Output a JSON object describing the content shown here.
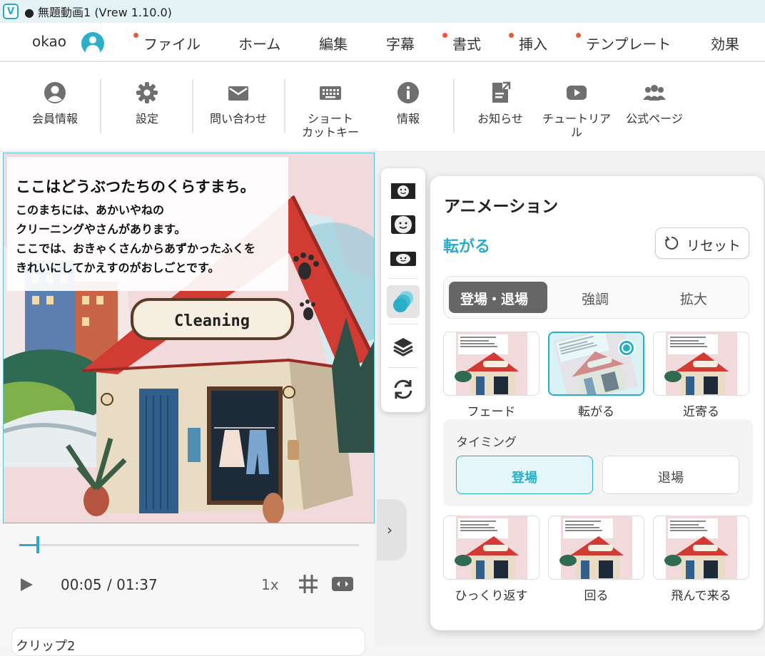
{
  "window": {
    "title": "● 無題動画1 (Vrew 1.10.0)",
    "logo_letter": "V"
  },
  "menubar": {
    "user_name": "okao",
    "items": [
      {
        "label": "ファイル",
        "dot": true
      },
      {
        "label": "ホーム",
        "dot": false
      },
      {
        "label": "編集",
        "dot": false
      },
      {
        "label": "字幕",
        "dot": false
      },
      {
        "label": "書式",
        "dot": true
      },
      {
        "label": "挿入",
        "dot": true
      },
      {
        "label": "テンプレート",
        "dot": true
      },
      {
        "label": "効果",
        "dot": false
      }
    ]
  },
  "toolbar": {
    "member_info": "会員情報",
    "settings": "設定",
    "contact": "問い合わせ",
    "shortcut_l1": "ショート",
    "shortcut_l2": "カットキー",
    "info": "情報",
    "news": "お知らせ",
    "tutorial_l1": "チュートリア",
    "tutorial_l2": "ル",
    "official": "公式ページ"
  },
  "preview": {
    "caption_title": "ここはどうぶつたちのくらすまち。",
    "caption_lines": [
      "このまちには、あかいやねの",
      "クリーニングやさんがあります。",
      "ここでは、おきゃくさんからあずかったふくを",
      "きれいにしてかえすのがおしごとです。"
    ],
    "sign_text": "Cleaning"
  },
  "playback": {
    "current_time": "00:05",
    "total_time": "/ 01:37",
    "speed": "1x",
    "progress": 0.05
  },
  "clip_card": {
    "label": "クリップ2"
  },
  "side_toolbar": {
    "icons": [
      "face-frame-small-icon",
      "face-frame-medium-icon",
      "face-frame-wide-icon",
      "animation-circles-icon",
      "layers-icon",
      "refresh-icon"
    ],
    "active": "animation-circles-icon"
  },
  "animation_panel": {
    "title": "アニメーション",
    "effect_name": "転がる",
    "reset_label": "リセット",
    "tabs": [
      "登場・退場",
      "強調",
      "拡大"
    ],
    "active_tab": "登場・退場",
    "effects_row1": [
      "フェード",
      "転がる",
      "近寄る"
    ],
    "selected_effect": "転がる",
    "timing_title": "タイミング",
    "timing_options": [
      "登場",
      "退場"
    ],
    "timing_selected": "登場",
    "effects_row2": [
      "ひっくり返す",
      "回る",
      "飛んで来る"
    ]
  },
  "colors": {
    "accent": "#2aaec7",
    "notice_dot": "#ec5a35",
    "roof_red": "#d23b34"
  }
}
